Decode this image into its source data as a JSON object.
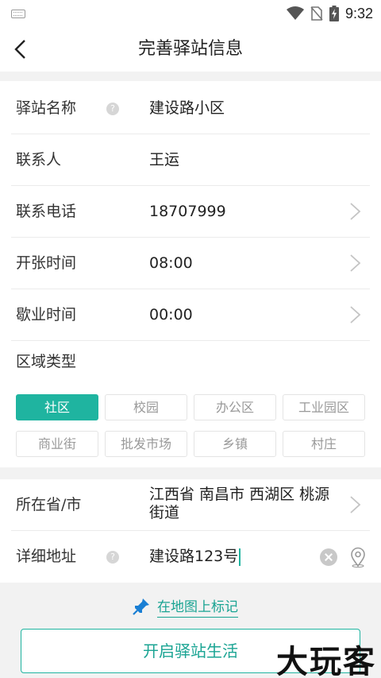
{
  "status_bar": {
    "time": "9:32"
  },
  "header": {
    "title": "完善驿站信息"
  },
  "form": {
    "station_name": {
      "label": "驿站名称",
      "help": "?",
      "value": "建设路小区"
    },
    "contact": {
      "label": "联系人",
      "value": "王运"
    },
    "phone": {
      "label": "联系电话",
      "value": "18707999"
    },
    "open_time": {
      "label": "开张时间",
      "value": "08:00"
    },
    "close_time": {
      "label": "歇业时间",
      "value": "00:00"
    },
    "area_type": {
      "label": "区域类型",
      "options": [
        "社区",
        "校园",
        "办公区",
        "工业园区",
        "商业街",
        "批发市场",
        "乡镇",
        "村庄"
      ],
      "selected": "社区"
    },
    "province_city": {
      "label": "所在省/市",
      "value": "江西省 南昌市 西湖区 桃源街道"
    },
    "detail_address": {
      "label": "详细地址",
      "help": "?",
      "value": "建设路123号"
    }
  },
  "map_link": {
    "label": "在地图上标记"
  },
  "submit": {
    "label": "开启驿站生活"
  },
  "watermark": {
    "text": "大玩客"
  },
  "colors": {
    "accent": "#1fb4a0",
    "link": "#1aa493"
  }
}
